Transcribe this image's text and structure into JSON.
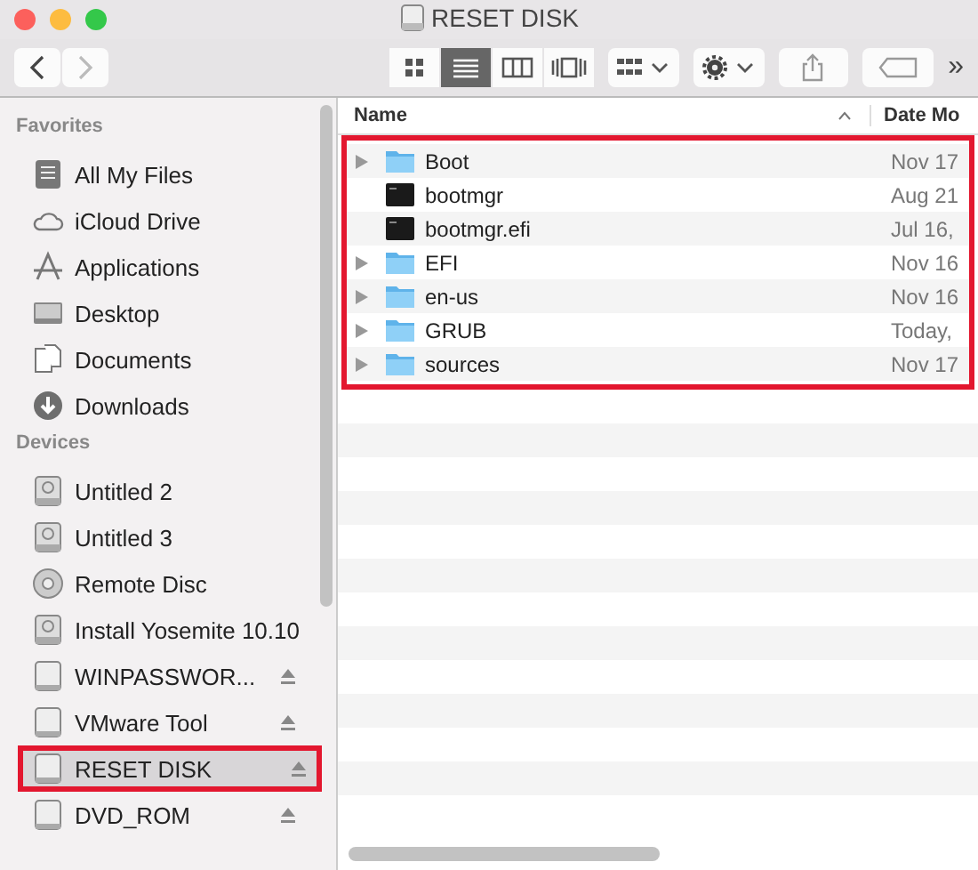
{
  "window": {
    "title": "RESET DISK"
  },
  "toolbar": {
    "view_modes": [
      {
        "kind": "icons",
        "selected": false
      },
      {
        "kind": "list",
        "selected": true
      },
      {
        "kind": "columns",
        "selected": false
      },
      {
        "kind": "coverflow",
        "selected": false
      }
    ],
    "overflow": "»"
  },
  "sidebar": {
    "sections": [
      {
        "title": "Favorites",
        "items": [
          {
            "label": "All My Files",
            "kind": "files",
            "selected": false,
            "eject": false,
            "highlighted": false
          },
          {
            "label": "iCloud Drive",
            "kind": "cloud",
            "selected": false,
            "eject": false,
            "highlighted": false
          },
          {
            "label": "Applications",
            "kind": "apps",
            "selected": false,
            "eject": false,
            "highlighted": false
          },
          {
            "label": "Desktop",
            "kind": "desktop",
            "selected": false,
            "eject": false,
            "highlighted": false
          },
          {
            "label": "Documents",
            "kind": "documents",
            "selected": false,
            "eject": false,
            "highlighted": false
          },
          {
            "label": "Downloads",
            "kind": "downloads",
            "selected": false,
            "eject": false,
            "highlighted": false
          }
        ]
      },
      {
        "title": "Devices",
        "items": [
          {
            "label": "Untitled 2",
            "kind": "disk",
            "selected": false,
            "eject": false,
            "highlighted": false
          },
          {
            "label": "Untitled 3",
            "kind": "disk",
            "selected": false,
            "eject": false,
            "highlighted": false
          },
          {
            "label": "Remote Disc",
            "kind": "disc",
            "selected": false,
            "eject": false,
            "highlighted": false
          },
          {
            "label": "Install Yosemite 10.10",
            "kind": "disk",
            "selected": false,
            "eject": false,
            "highlighted": false
          },
          {
            "label": "WINPASSWOR...",
            "kind": "drive",
            "selected": false,
            "eject": true,
            "highlighted": false
          },
          {
            "label": "VMware Tool",
            "kind": "drive",
            "selected": false,
            "eject": true,
            "highlighted": false
          },
          {
            "label": "RESET DISK",
            "kind": "drive",
            "selected": true,
            "eject": true,
            "highlighted": true
          },
          {
            "label": "DVD_ROM",
            "kind": "drive",
            "selected": false,
            "eject": true,
            "highlighted": false
          }
        ]
      }
    ]
  },
  "file_list": {
    "columns": [
      "Name",
      "Date Mo"
    ],
    "highlighted": true,
    "rows": [
      {
        "name": "Boot",
        "kind": "folder",
        "date": "Nov 17"
      },
      {
        "name": "bootmgr",
        "kind": "executable",
        "date": "Aug 21"
      },
      {
        "name": "bootmgr.efi",
        "kind": "executable",
        "date": "Jul 16,"
      },
      {
        "name": "EFI",
        "kind": "folder",
        "date": "Nov 16"
      },
      {
        "name": "en-us",
        "kind": "folder",
        "date": "Nov 16"
      },
      {
        "name": "GRUB",
        "kind": "folder",
        "date": "Today,"
      },
      {
        "name": "sources",
        "kind": "folder",
        "date": "Nov 17"
      }
    ]
  }
}
